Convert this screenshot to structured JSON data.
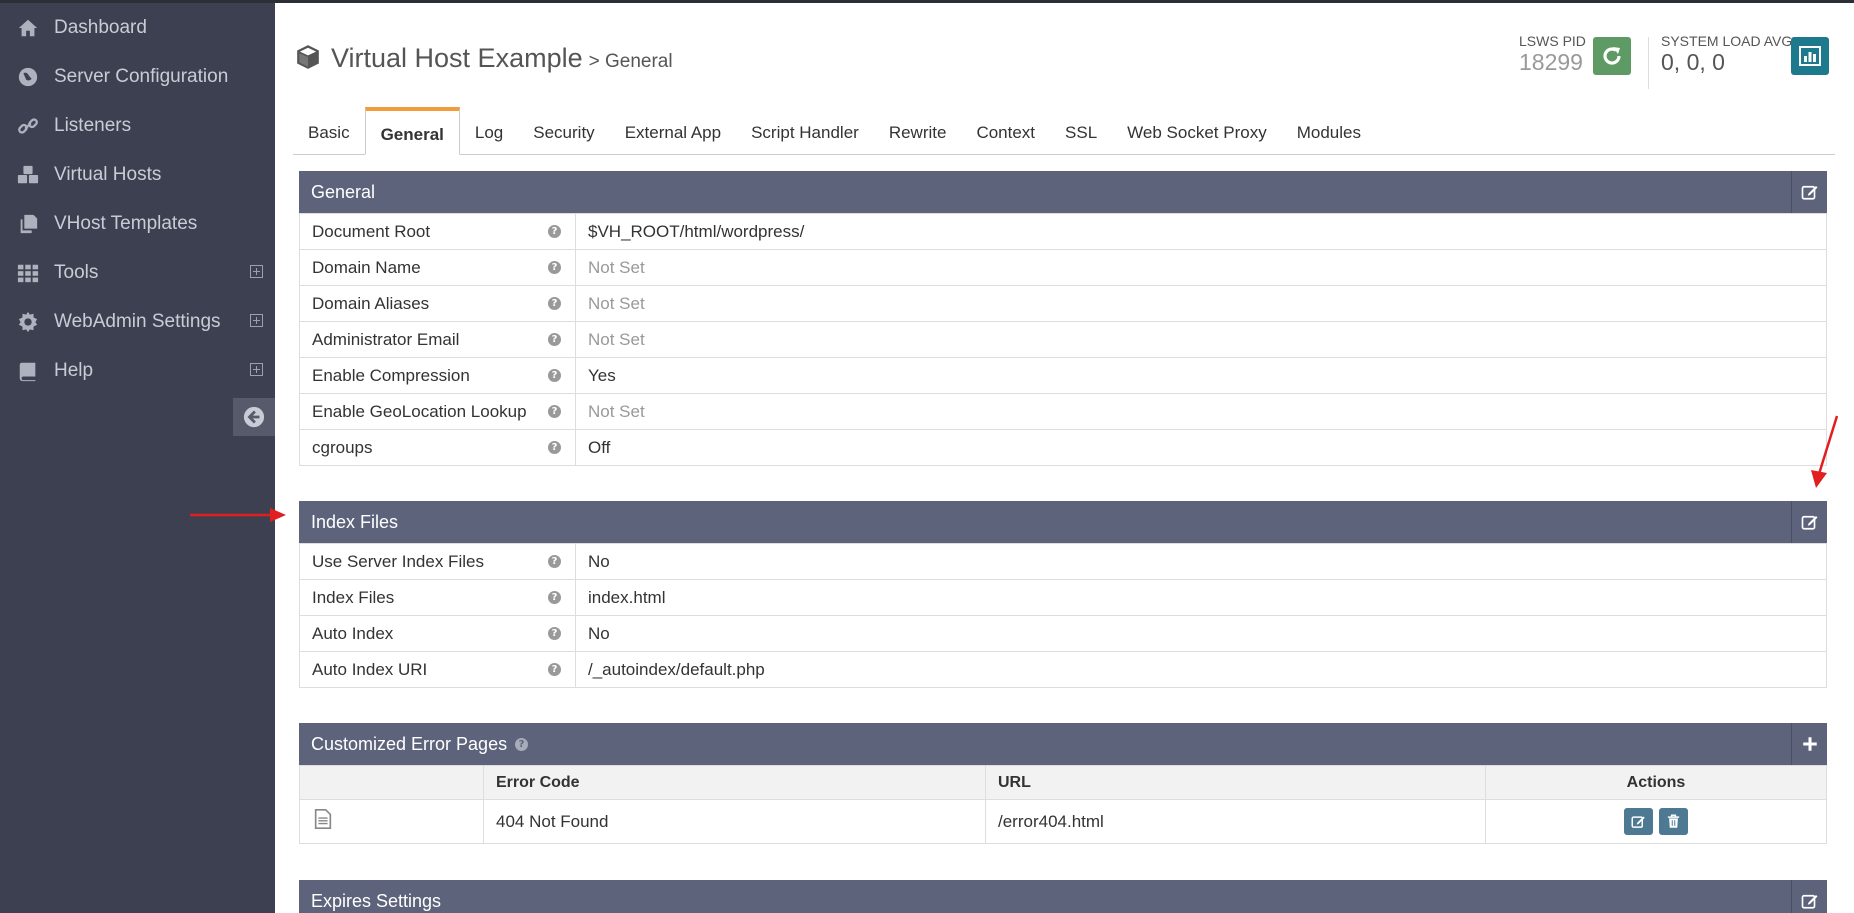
{
  "sidebar": {
    "items": [
      {
        "label": "Dashboard",
        "icon": "home-icon",
        "expandable": false
      },
      {
        "label": "Server Configuration",
        "icon": "globe-icon",
        "expandable": false
      },
      {
        "label": "Listeners",
        "icon": "link-icon",
        "expandable": false
      },
      {
        "label": "Virtual Hosts",
        "icon": "cubes-icon",
        "expandable": false
      },
      {
        "label": "VHost Templates",
        "icon": "copy-icon",
        "expandable": false
      },
      {
        "label": "Tools",
        "icon": "grid-icon",
        "expandable": true
      },
      {
        "label": "WebAdmin Settings",
        "icon": "gear-icon",
        "expandable": true
      },
      {
        "label": "Help",
        "icon": "book-icon",
        "expandable": true
      }
    ]
  },
  "header": {
    "title": "Virtual Host Example",
    "subtitle": "> General",
    "pid_label": "LSWS PID",
    "pid_value": "18299",
    "load_label": "SYSTEM LOAD AVG",
    "load_value": "0, 0, 0"
  },
  "tabs": [
    "Basic",
    "General",
    "Log",
    "Security",
    "External App",
    "Script Handler",
    "Rewrite",
    "Context",
    "SSL",
    "Web Socket Proxy",
    "Modules"
  ],
  "active_tab": "General",
  "general": {
    "title": "General",
    "rows": [
      {
        "key": "Document Root",
        "value": "$VH_ROOT/html/wordpress/",
        "notset": false
      },
      {
        "key": "Domain Name",
        "value": "Not Set",
        "notset": true
      },
      {
        "key": "Domain Aliases",
        "value": "Not Set",
        "notset": true
      },
      {
        "key": "Administrator Email",
        "value": "Not Set",
        "notset": true
      },
      {
        "key": "Enable Compression",
        "value": "Yes",
        "notset": false
      },
      {
        "key": "Enable GeoLocation Lookup",
        "value": "Not Set",
        "notset": true
      },
      {
        "key": "cgroups",
        "value": "Off",
        "notset": false
      }
    ]
  },
  "index_files": {
    "title": "Index Files",
    "rows": [
      {
        "key": "Use Server Index Files",
        "value": "No"
      },
      {
        "key": "Index Files",
        "value": "index.html"
      },
      {
        "key": "Auto Index",
        "value": "No"
      },
      {
        "key": "Auto Index URI",
        "value": "/_autoindex/default.php"
      }
    ]
  },
  "error_pages": {
    "title": "Customized Error Pages",
    "columns": [
      "",
      "Error Code",
      "URL",
      "Actions"
    ],
    "rows": [
      {
        "code": "404 Not Found",
        "url": "/error404.html"
      }
    ]
  },
  "expires": {
    "title": "Expires Settings"
  },
  "help_glyph": "?",
  "colors": {
    "sidebar_bg": "#3d4050",
    "panel_header": "#5e637c",
    "tab_accent": "#f39c3c",
    "refresh_btn": "#5e9a63",
    "stats_btn": "#1c7a8c",
    "action_btn": "#4e7993",
    "annotation_arrow": "#e02020"
  }
}
